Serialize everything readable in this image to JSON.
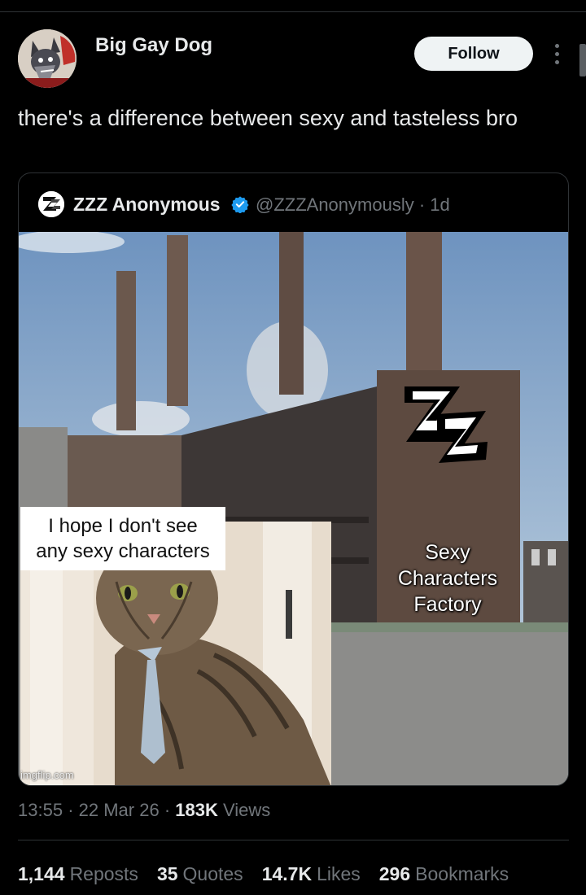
{
  "author": {
    "name": "Big Gay Dog"
  },
  "follow_label": "Follow",
  "tweet_text": "there's a difference between sexy and tasteless bro",
  "quote": {
    "name": "ZZZ Anonymous",
    "handle_time": "@ZZZAnonymously · 1d",
    "meme": {
      "bubble_line1": "I hope I don't see",
      "bubble_line2": "any sexy characters",
      "label_line1": "Sexy",
      "label_line2": "Characters",
      "label_line3": "Factory",
      "logo_text": "ZZ",
      "watermark": "imgflip.com"
    }
  },
  "meta": {
    "time": "13:55",
    "date": "22 Mar 26",
    "views_count": "183K",
    "views_label": "Views",
    "sep": "·"
  },
  "stats": {
    "reposts_count": "1,144",
    "reposts_label": "Reposts",
    "quotes_count": "35",
    "quotes_label": "Quotes",
    "likes_count": "14.7K",
    "likes_label": "Likes",
    "bookmarks_count": "296",
    "bookmarks_label": "Bookmarks"
  },
  "colors": {
    "background": "#000000",
    "text": "#e7e9ea",
    "muted": "#71767b",
    "verified": "#1d9bf0",
    "border": "#2f3336"
  }
}
